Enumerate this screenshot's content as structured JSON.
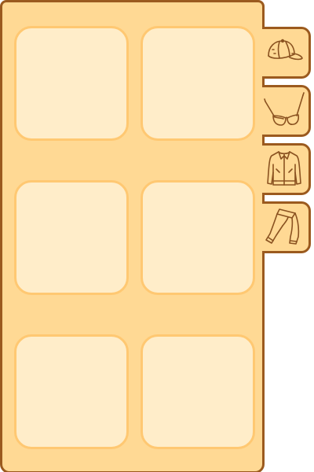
{
  "inventory": {
    "slot_count": 6,
    "tabs": [
      {
        "icon": "cap-icon"
      },
      {
        "icon": "sunglasses-icon"
      },
      {
        "icon": "jacket-icon"
      },
      {
        "icon": "pants-icon"
      }
    ]
  },
  "colors": {
    "panel_fill": "#FFD994",
    "panel_border": "#9B5A1E",
    "slot_fill": "#FFEDC9",
    "slot_border": "#FFC872",
    "icon_stroke": "#8A5220"
  }
}
